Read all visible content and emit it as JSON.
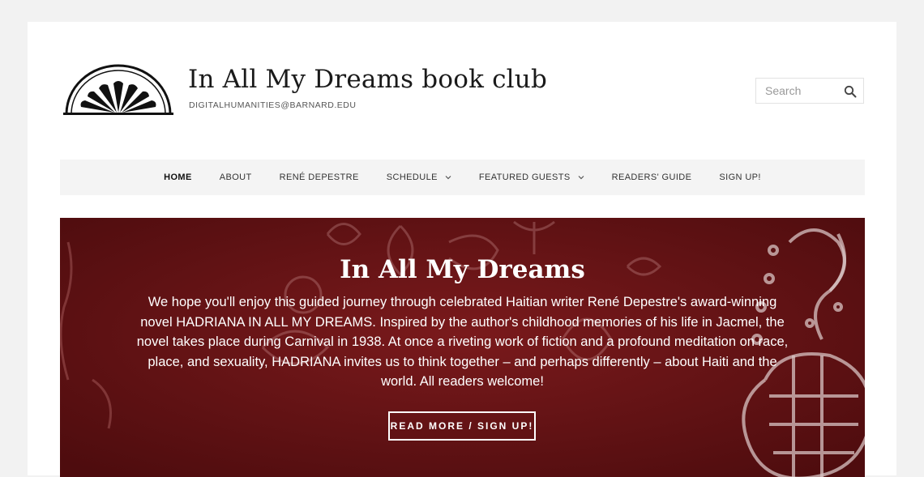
{
  "header": {
    "site_title": "In All My Dreams book club",
    "site_description": "DIGITALHUMANITIES@BARNARD.EDU",
    "logo_icon": "sunburst-arch-logo"
  },
  "search": {
    "placeholder": "Search",
    "value": "",
    "icon": "search-icon"
  },
  "nav": {
    "items": [
      {
        "label": "HOME",
        "active": true
      },
      {
        "label": "ABOUT"
      },
      {
        "label": "RENÉ DEPESTRE"
      },
      {
        "label": "SCHEDULE",
        "has_dropdown": true
      },
      {
        "label": "FEATURED GUESTS",
        "has_dropdown": true
      },
      {
        "label": "READERS' GUIDE"
      },
      {
        "label": "SIGN UP!"
      }
    ]
  },
  "hero": {
    "title": "In All My Dreams",
    "text": "We hope you'll enjoy this guided journey through celebrated Haitian writer René Depestre's award-winning novel HADRIANA IN ALL MY DREAMS. Inspired by the author's childhood memories of his life in Jacmel, the novel takes place during Carnival in 1938. At once a riveting work of fiction and a profound meditation on race, place, and sexuality, HADRIANA invites us to think together – and perhaps differently – about Haiti and the world. All readers welcome!",
    "button_label": "READ MORE / SIGN UP!"
  },
  "colors": {
    "hero_background": "#6c1416",
    "page_background": "#f2f2f2",
    "nav_background": "#f4f4f4"
  }
}
